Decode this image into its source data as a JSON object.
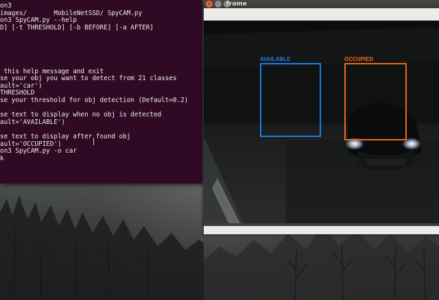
{
  "terminal": {
    "lines": [
      "on3",
      "images/       MobileNetSSD/ SpyCAM.py",
      "on3 SpyCAM.py --help",
      "D] [-t THRESHOLD] [-b BEFORE] [-a AFTER]",
      "",
      "",
      "",
      " this help message and exit",
      "se your obj you want to detect from 21 classes",
      "ault='car')",
      "THRESHOLD",
      "se your threshold for obj detection (Default=0.2)",
      "",
      "",
      "se text to display when no obj is detected",
      "ault='AVAILABLE')",
      "",
      "se text to display after found obj",
      "ault='OCCUPIED')",
      "on3 SpyCAM.py -o car",
      "k"
    ]
  },
  "frame_window": {
    "title": "frame",
    "close_glyph": "×",
    "available_label": "AVAILABLE",
    "occupied_label": "OCCUPIED",
    "available_color": "#1e7fe6",
    "occupied_color": "#f06a1c"
  }
}
